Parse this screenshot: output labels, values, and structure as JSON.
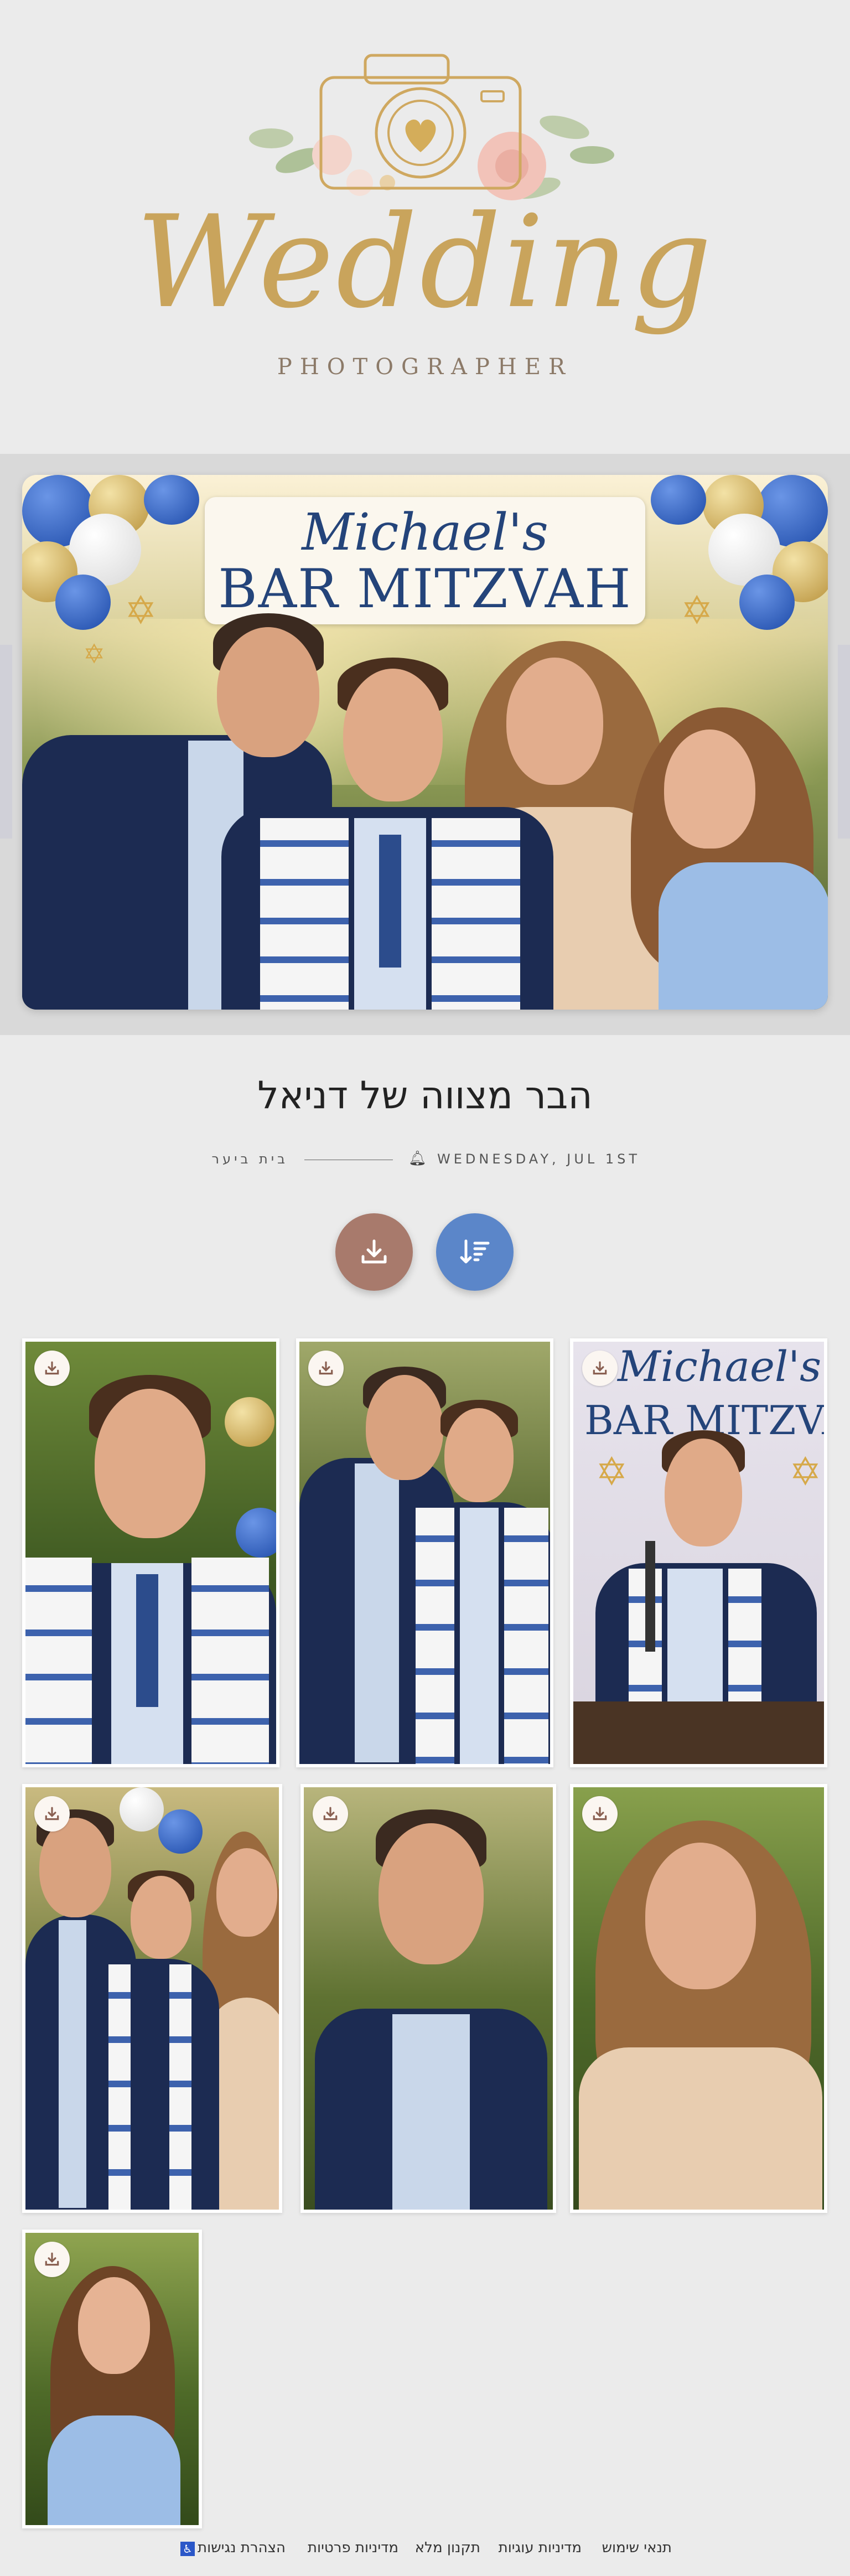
{
  "logo": {
    "word": "Wedding",
    "subtitle": "PHOTOGRAPHER",
    "icon": "camera-heart-icon"
  },
  "cover": {
    "banner_line1": "Michael's",
    "banner_line2": "BAR MITZVAH"
  },
  "event": {
    "title": "הבר מצווה של דניאל",
    "place": "בית ביער",
    "date": "WEDNESDAY, JUL 1ST",
    "bell_icon": "bell-icon"
  },
  "actions": {
    "download_icon": "download-icon",
    "sort_icon": "sort-icon"
  },
  "gallery": {
    "photos": [
      {
        "subject": "boy-tallit",
        "badge_icon": "download-icon"
      },
      {
        "subject": "father-son",
        "badge_icon": "download-icon"
      },
      {
        "subject": "boy-speech",
        "badge_icon": "download-icon",
        "sign_line1": "Michael's",
        "sign_line2": "BAR MITZVAH"
      },
      {
        "subject": "family",
        "badge_icon": "download-icon"
      },
      {
        "subject": "father",
        "badge_icon": "download-icon"
      },
      {
        "subject": "mother",
        "badge_icon": "download-icon"
      },
      {
        "subject": "sister",
        "badge_icon": "download-icon"
      }
    ]
  },
  "footer": {
    "links": [
      "תנאי שימוש",
      "מדיניות עוגיות",
      "תקנון מלא",
      "מדיניות פרטיות",
      "הצהרת נגישות"
    ],
    "accessibility_icon": "accessibility-icon"
  },
  "colors": {
    "gold": "#c9a45c",
    "navy": "#24447a",
    "download_button": "#a87a6c",
    "sort_button": "#5b86c9"
  }
}
